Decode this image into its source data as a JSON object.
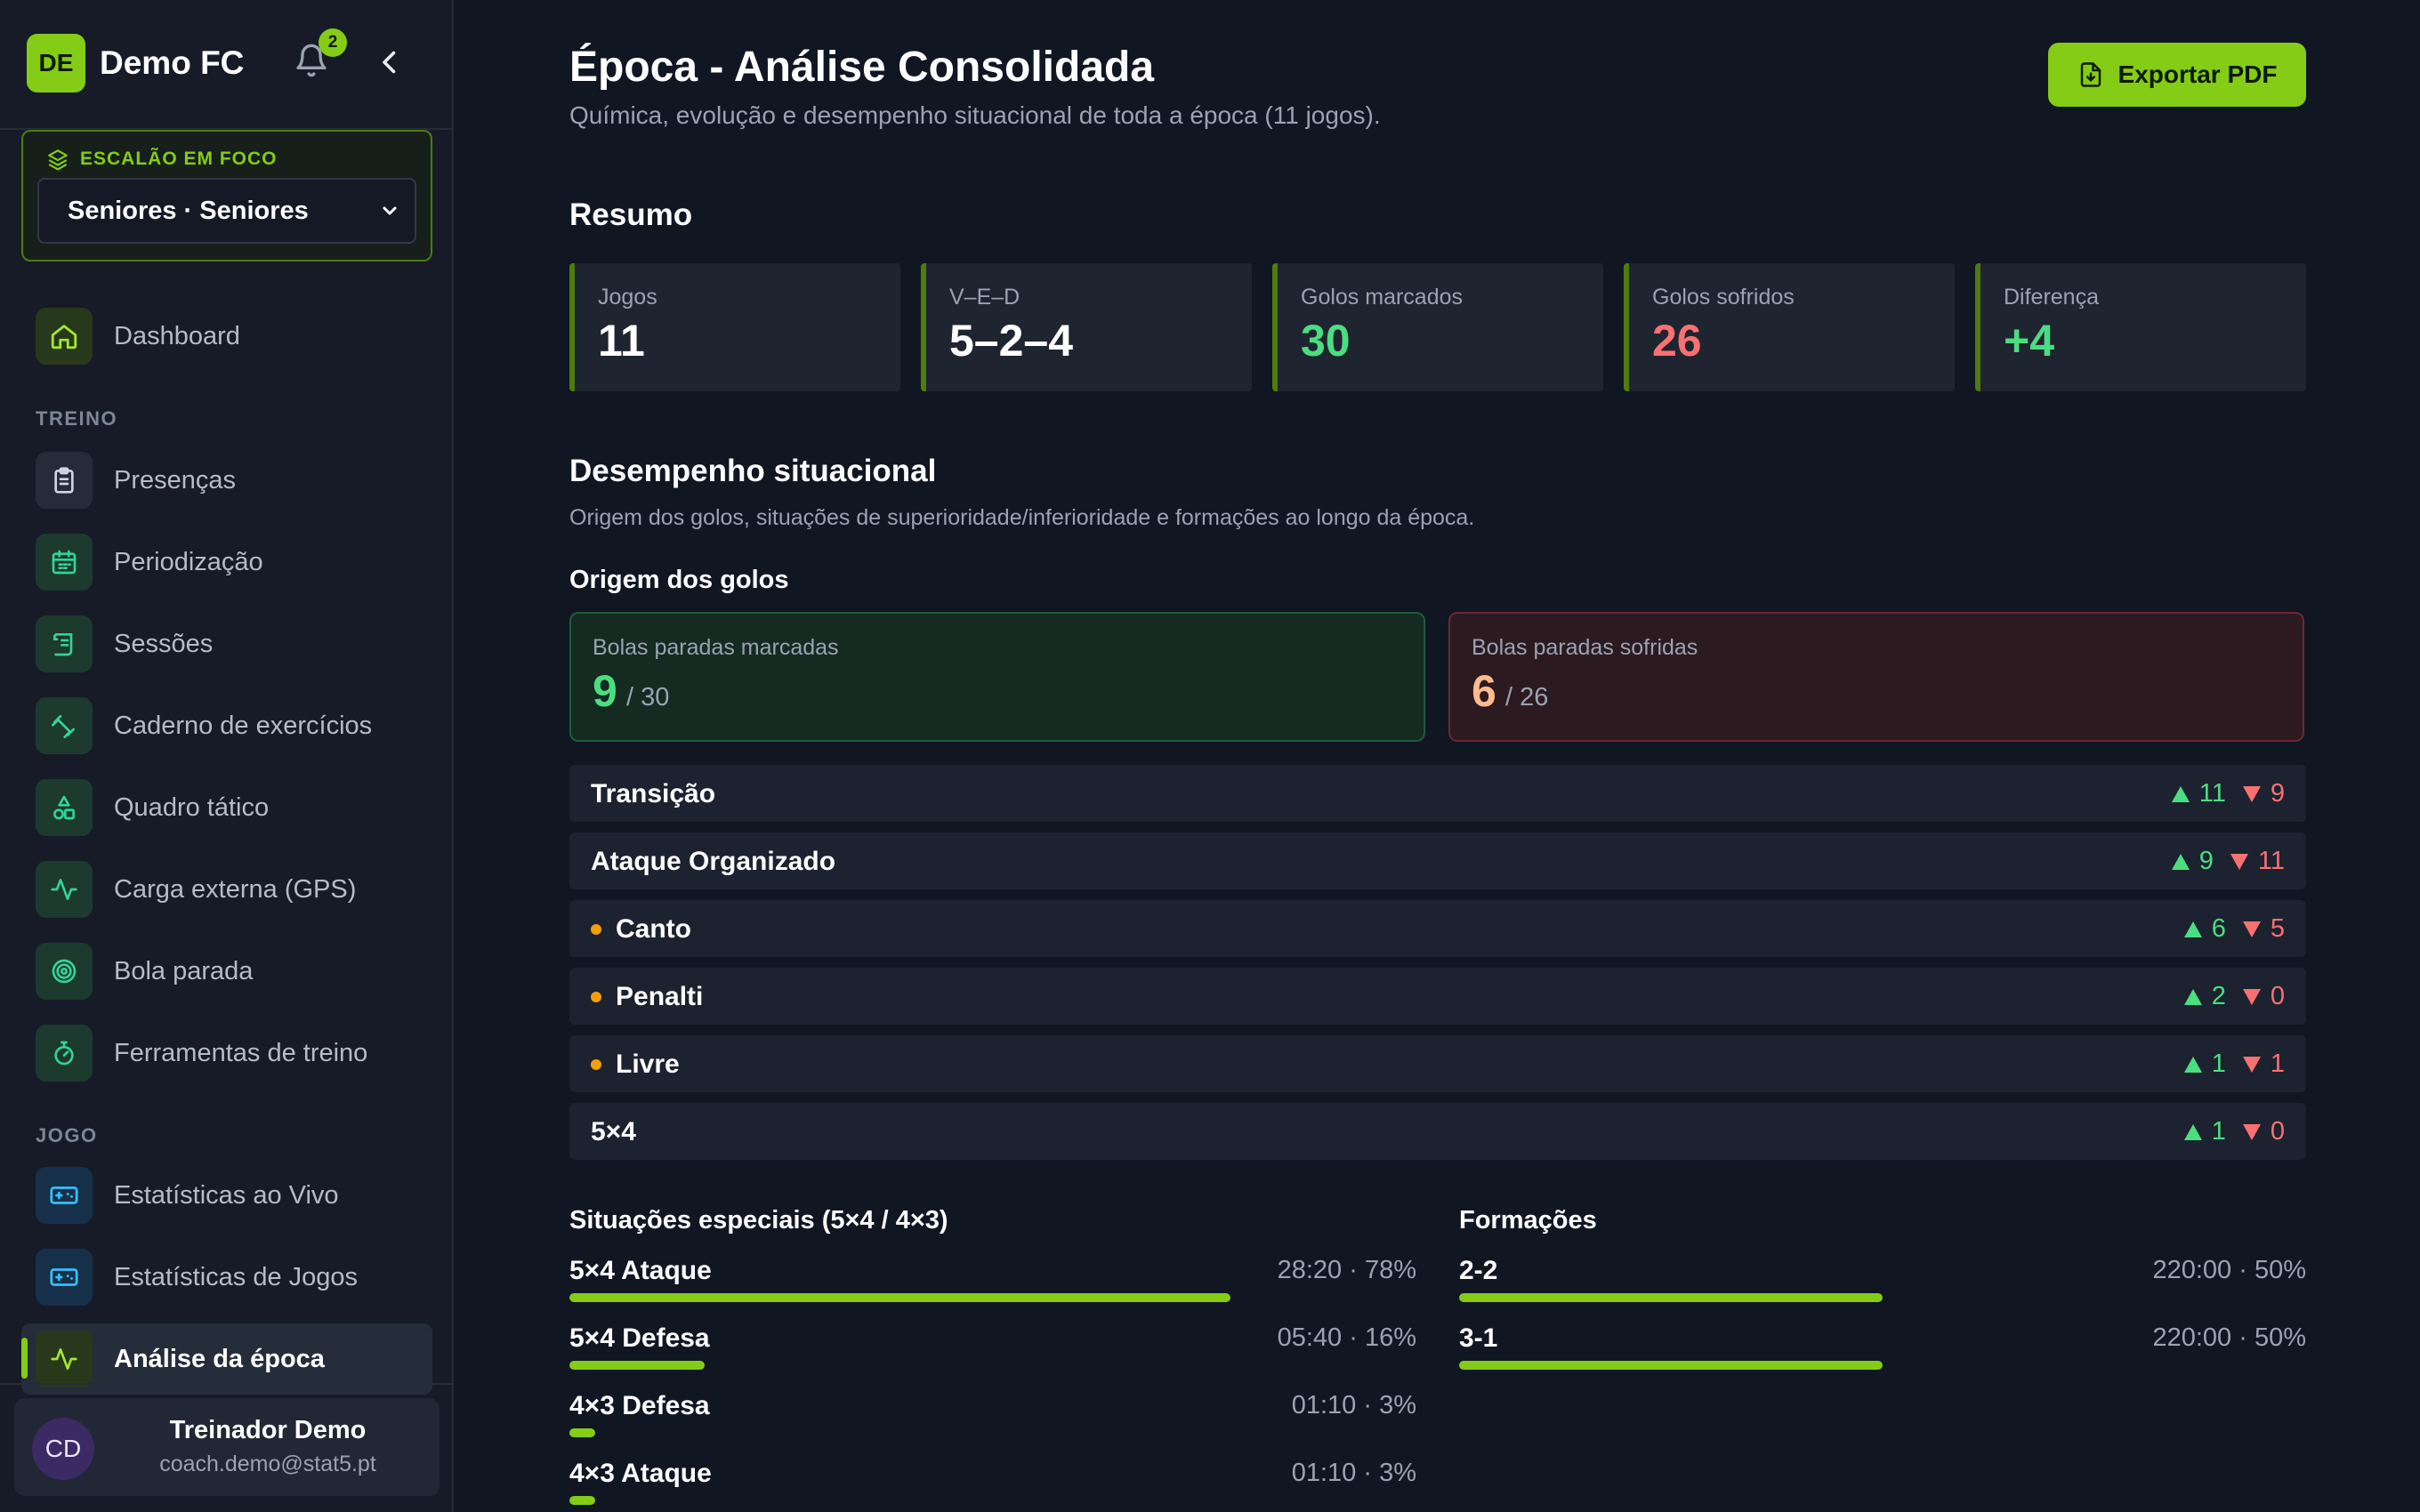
{
  "app": {
    "name": "Demo FC",
    "logo_initials": "DE",
    "notifications_count": "2"
  },
  "focus": {
    "label": "ESCALÃO EM FOCO",
    "selected": "Seniores · Seniores"
  },
  "nav": {
    "dashboard": "Dashboard",
    "section_treino": "TREINO",
    "treino_items": [
      "Presenças",
      "Periodização",
      "Sessões",
      "Caderno de exercícios",
      "Quadro tático",
      "Carga externa (GPS)",
      "Bola parada",
      "Ferramentas de treino"
    ],
    "section_jogo": "JOGO",
    "jogo_items": [
      "Estatísticas ao Vivo",
      "Estatísticas de Jogos",
      "Análise da época"
    ],
    "active": "Análise da época"
  },
  "user": {
    "initials": "CD",
    "name": "Treinador Demo",
    "email": "coach.demo@stat5.pt"
  },
  "header": {
    "title": "Época - Análise Consolidada",
    "subtitle": "Química, evolução e desempenho situacional de toda a época (11 jogos).",
    "export_label": "Exportar PDF"
  },
  "summary": {
    "title": "Resumo",
    "cards": [
      {
        "label": "Jogos",
        "value": "11"
      },
      {
        "label": "V–E–D",
        "value": "5–2–4"
      },
      {
        "label": "Golos marcados",
        "value": "30"
      },
      {
        "label": "Golos sofridos",
        "value": "26"
      },
      {
        "label": "Diferença",
        "value": "+4"
      }
    ]
  },
  "situational": {
    "title": "Desempenho situacional",
    "subtitle": "Origem dos golos, situações de superioridade/inferioridade e formações ao longo da época.",
    "origin_title": "Origem dos golos",
    "set_pieces_for": {
      "label": "Bolas paradas marcadas",
      "value": "9",
      "total": "/ 30"
    },
    "set_pieces_against": {
      "label": "Bolas paradas sofridas",
      "value": "6",
      "total": "/ 26"
    },
    "rows": [
      {
        "label": "Transição",
        "scored": "11",
        "conceded": "9",
        "sub": false
      },
      {
        "label": "Ataque Organizado",
        "scored": "9",
        "conceded": "11",
        "sub": false
      },
      {
        "label": "Canto",
        "scored": "6",
        "conceded": "5",
        "sub": true
      },
      {
        "label": "Penalti",
        "scored": "2",
        "conceded": "0",
        "sub": true
      },
      {
        "label": "Livre",
        "scored": "1",
        "conceded": "1",
        "sub": true
      },
      {
        "label": "5×4",
        "scored": "1",
        "conceded": "0",
        "sub": false
      }
    ],
    "special_title": "Situações especiais (5×4 / 4×3)",
    "special": [
      {
        "label": "5×4 Ataque",
        "value": "28:20 · 78%",
        "pct": 78
      },
      {
        "label": "5×4 Defesa",
        "value": "05:40 · 16%",
        "pct": 16
      },
      {
        "label": "4×3 Defesa",
        "value": "01:10 · 3%",
        "pct": 3
      },
      {
        "label": "4×3 Ataque",
        "value": "01:10 · 3%",
        "pct": 3
      }
    ],
    "formations_title": "Formações",
    "formations": [
      {
        "label": "2-2",
        "value": "220:00 · 50%",
        "pct": 50
      },
      {
        "label": "3-1",
        "value": "220:00 · 50%",
        "pct": 50
      }
    ]
  },
  "colors": {
    "accent": "#84cc16",
    "positive": "#4ade80",
    "negative": "#f87171",
    "background": "#111623"
  }
}
